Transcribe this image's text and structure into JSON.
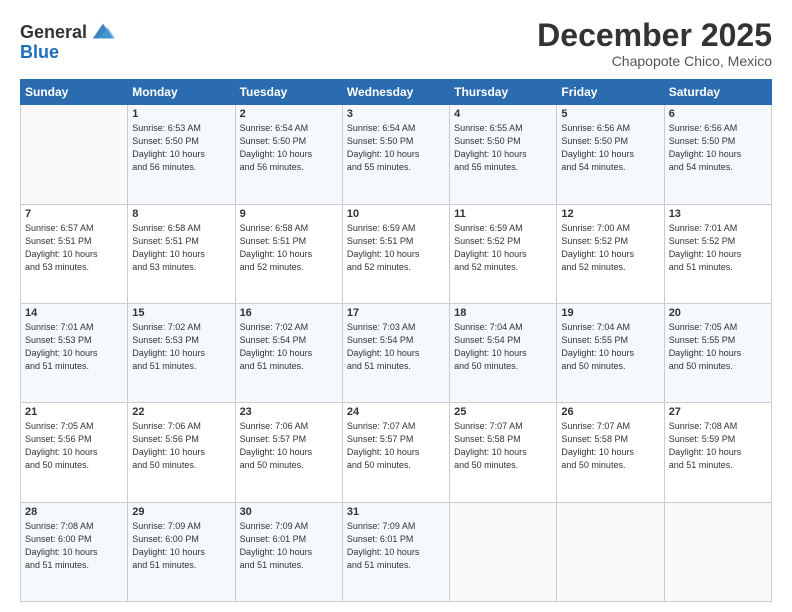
{
  "header": {
    "logo_line1": "General",
    "logo_line2": "Blue",
    "month": "December 2025",
    "location": "Chapopote Chico, Mexico"
  },
  "days_of_week": [
    "Sunday",
    "Monday",
    "Tuesday",
    "Wednesday",
    "Thursday",
    "Friday",
    "Saturday"
  ],
  "weeks": [
    [
      {
        "day": "",
        "info": ""
      },
      {
        "day": "1",
        "info": "Sunrise: 6:53 AM\nSunset: 5:50 PM\nDaylight: 10 hours\nand 56 minutes."
      },
      {
        "day": "2",
        "info": "Sunrise: 6:54 AM\nSunset: 5:50 PM\nDaylight: 10 hours\nand 56 minutes."
      },
      {
        "day": "3",
        "info": "Sunrise: 6:54 AM\nSunset: 5:50 PM\nDaylight: 10 hours\nand 55 minutes."
      },
      {
        "day": "4",
        "info": "Sunrise: 6:55 AM\nSunset: 5:50 PM\nDaylight: 10 hours\nand 55 minutes."
      },
      {
        "day": "5",
        "info": "Sunrise: 6:56 AM\nSunset: 5:50 PM\nDaylight: 10 hours\nand 54 minutes."
      },
      {
        "day": "6",
        "info": "Sunrise: 6:56 AM\nSunset: 5:50 PM\nDaylight: 10 hours\nand 54 minutes."
      }
    ],
    [
      {
        "day": "7",
        "info": "Sunrise: 6:57 AM\nSunset: 5:51 PM\nDaylight: 10 hours\nand 53 minutes."
      },
      {
        "day": "8",
        "info": "Sunrise: 6:58 AM\nSunset: 5:51 PM\nDaylight: 10 hours\nand 53 minutes."
      },
      {
        "day": "9",
        "info": "Sunrise: 6:58 AM\nSunset: 5:51 PM\nDaylight: 10 hours\nand 52 minutes."
      },
      {
        "day": "10",
        "info": "Sunrise: 6:59 AM\nSunset: 5:51 PM\nDaylight: 10 hours\nand 52 minutes."
      },
      {
        "day": "11",
        "info": "Sunrise: 6:59 AM\nSunset: 5:52 PM\nDaylight: 10 hours\nand 52 minutes."
      },
      {
        "day": "12",
        "info": "Sunrise: 7:00 AM\nSunset: 5:52 PM\nDaylight: 10 hours\nand 52 minutes."
      },
      {
        "day": "13",
        "info": "Sunrise: 7:01 AM\nSunset: 5:52 PM\nDaylight: 10 hours\nand 51 minutes."
      }
    ],
    [
      {
        "day": "14",
        "info": "Sunrise: 7:01 AM\nSunset: 5:53 PM\nDaylight: 10 hours\nand 51 minutes."
      },
      {
        "day": "15",
        "info": "Sunrise: 7:02 AM\nSunset: 5:53 PM\nDaylight: 10 hours\nand 51 minutes."
      },
      {
        "day": "16",
        "info": "Sunrise: 7:02 AM\nSunset: 5:54 PM\nDaylight: 10 hours\nand 51 minutes."
      },
      {
        "day": "17",
        "info": "Sunrise: 7:03 AM\nSunset: 5:54 PM\nDaylight: 10 hours\nand 51 minutes."
      },
      {
        "day": "18",
        "info": "Sunrise: 7:04 AM\nSunset: 5:54 PM\nDaylight: 10 hours\nand 50 minutes."
      },
      {
        "day": "19",
        "info": "Sunrise: 7:04 AM\nSunset: 5:55 PM\nDaylight: 10 hours\nand 50 minutes."
      },
      {
        "day": "20",
        "info": "Sunrise: 7:05 AM\nSunset: 5:55 PM\nDaylight: 10 hours\nand 50 minutes."
      }
    ],
    [
      {
        "day": "21",
        "info": "Sunrise: 7:05 AM\nSunset: 5:56 PM\nDaylight: 10 hours\nand 50 minutes."
      },
      {
        "day": "22",
        "info": "Sunrise: 7:06 AM\nSunset: 5:56 PM\nDaylight: 10 hours\nand 50 minutes."
      },
      {
        "day": "23",
        "info": "Sunrise: 7:06 AM\nSunset: 5:57 PM\nDaylight: 10 hours\nand 50 minutes."
      },
      {
        "day": "24",
        "info": "Sunrise: 7:07 AM\nSunset: 5:57 PM\nDaylight: 10 hours\nand 50 minutes."
      },
      {
        "day": "25",
        "info": "Sunrise: 7:07 AM\nSunset: 5:58 PM\nDaylight: 10 hours\nand 50 minutes."
      },
      {
        "day": "26",
        "info": "Sunrise: 7:07 AM\nSunset: 5:58 PM\nDaylight: 10 hours\nand 50 minutes."
      },
      {
        "day": "27",
        "info": "Sunrise: 7:08 AM\nSunset: 5:59 PM\nDaylight: 10 hours\nand 51 minutes."
      }
    ],
    [
      {
        "day": "28",
        "info": "Sunrise: 7:08 AM\nSunset: 6:00 PM\nDaylight: 10 hours\nand 51 minutes."
      },
      {
        "day": "29",
        "info": "Sunrise: 7:09 AM\nSunset: 6:00 PM\nDaylight: 10 hours\nand 51 minutes."
      },
      {
        "day": "30",
        "info": "Sunrise: 7:09 AM\nSunset: 6:01 PM\nDaylight: 10 hours\nand 51 minutes."
      },
      {
        "day": "31",
        "info": "Sunrise: 7:09 AM\nSunset: 6:01 PM\nDaylight: 10 hours\nand 51 minutes."
      },
      {
        "day": "",
        "info": ""
      },
      {
        "day": "",
        "info": ""
      },
      {
        "day": "",
        "info": ""
      }
    ]
  ]
}
